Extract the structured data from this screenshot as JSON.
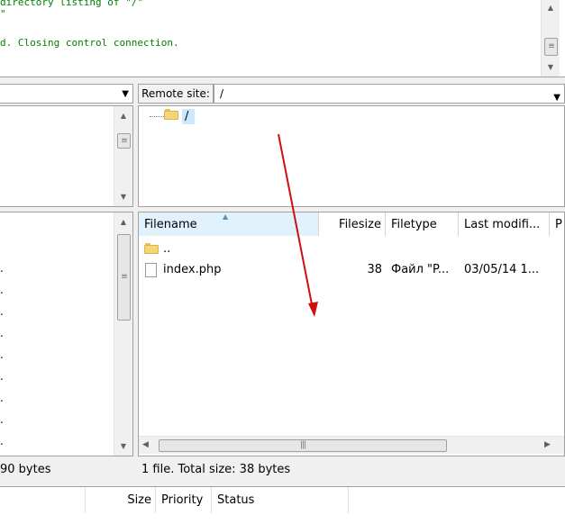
{
  "message_log": {
    "lines": [
      "directory listing of \"/\"",
      "\"",
      "d. Closing control connection."
    ]
  },
  "local": {
    "file_rows_marker": ".",
    "status": "90 bytes"
  },
  "remote": {
    "site_label": "Remote site:",
    "path": "/",
    "tree_root": "/",
    "columns": [
      "Filename",
      "Filesize",
      "Filetype",
      "Last modifi...",
      "P"
    ],
    "rows": [
      {
        "name": "..",
        "size": "",
        "type": "",
        "modified": ""
      },
      {
        "name": "index.php",
        "size": "38",
        "type": "Файл \"P...",
        "modified": "03/05/14 1..."
      }
    ],
    "status": "1 file. Total size: 38 bytes"
  },
  "queue": {
    "columns": [
      "Size",
      "Priority",
      "Status"
    ]
  },
  "icons": {
    "dropdown": "chevron-down-icon",
    "folder": "folder-icon",
    "file": "file-icon",
    "annotation": "red-arrow-annotation"
  },
  "colors": {
    "log_text": "#008000",
    "annotation": "#d01010",
    "selection": "#cce8ff"
  }
}
